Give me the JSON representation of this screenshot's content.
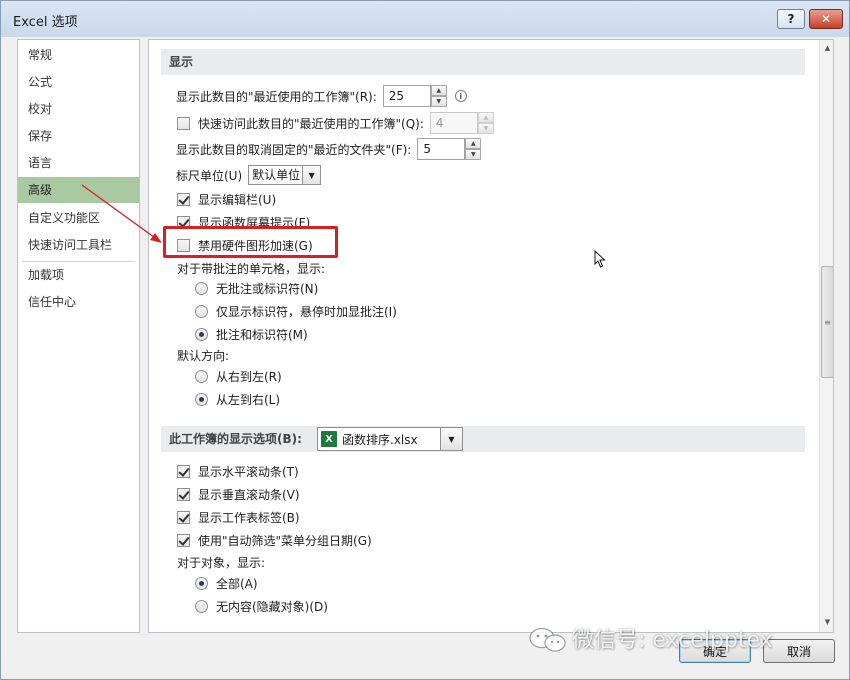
{
  "window": {
    "title": "Excel 选项",
    "help_label": "?",
    "close_label": "✕"
  },
  "nav": {
    "items": [
      {
        "label": "常规",
        "selected": false
      },
      {
        "label": "公式",
        "selected": false
      },
      {
        "label": "校对",
        "selected": false
      },
      {
        "label": "保存",
        "selected": false
      },
      {
        "label": "语言",
        "selected": false
      },
      {
        "label": "高级",
        "selected": true
      },
      {
        "label": "自定义功能区",
        "selected": false
      },
      {
        "label": "快速访问工具栏",
        "selected": false
      },
      {
        "label": "加载项",
        "selected": false
      },
      {
        "label": "信任中心",
        "selected": false
      }
    ],
    "selected_color": "#a9c9a1"
  },
  "display": {
    "header": "显示",
    "recent_workbooks": {
      "label": "显示此数目的\"最近使用的工作簿\"(R):",
      "value": "25"
    },
    "quick_access_recent": {
      "label": "快速访问此数目的\"最近使用的工作簿\"(Q):",
      "value": "4",
      "checked": false
    },
    "unpinned_folders": {
      "label": "显示此数目的取消固定的\"最近的文件夹\"(F):",
      "value": "5"
    },
    "ruler_units": {
      "label": "标尺单位(U)",
      "value": "默认单位"
    },
    "show_formula_bar": {
      "label": "显示编辑栏(U)",
      "checked": true
    },
    "show_function_tooltips": {
      "label": "显示函数屏幕提示(F)",
      "checked": true
    },
    "disable_hw_accel": {
      "label": "禁用硬件图形加速(G)",
      "checked": false
    },
    "comments_caption": "对于带批注的单元格，显示:",
    "comments_options": [
      {
        "label": "无批注或标识符(N)",
        "selected": false
      },
      {
        "label": "仅显示标识符，悬停时加显批注(I)",
        "selected": false
      },
      {
        "label": "批注和标识符(M)",
        "selected": true
      }
    ],
    "direction_caption": "默认方向:",
    "direction_options": [
      {
        "label": "从右到左(R)",
        "selected": false
      },
      {
        "label": "从左到右(L)",
        "selected": true
      }
    ]
  },
  "workbook_display": {
    "header": "此工作簿的显示选项(B):",
    "workbook_name": "函数排序.xlsx",
    "excel_icon_letter": "X",
    "show_h_scroll": {
      "label": "显示水平滚动条(T)",
      "checked": true
    },
    "show_v_scroll": {
      "label": "显示垂直滚动条(V)",
      "checked": true
    },
    "show_sheet_tabs": {
      "label": "显示工作表标签(B)",
      "checked": true
    },
    "group_dates": {
      "label": "使用\"自动筛选\"菜单分组日期(G)",
      "checked": true
    },
    "objects_caption": "对于对象，显示:",
    "objects_options": [
      {
        "label": "全部(A)",
        "selected": true
      },
      {
        "label": "无内容(隐藏对象)(D)",
        "selected": false
      }
    ]
  },
  "buttons": {
    "ok_label": "确定",
    "cancel_label": "取消"
  },
  "watermark": {
    "text": "微信号: excelpptex"
  },
  "colors": {
    "highlight": "#d42224",
    "accent_border": "#3c7fb1"
  }
}
